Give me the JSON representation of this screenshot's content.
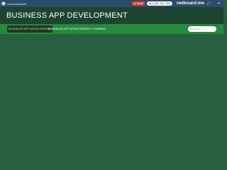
{
  "topbar": {
    "username": "coconutbeaver",
    "share_label": "Share",
    "share_icon": "share-icon",
    "stats": [
      {
        "icon": "eye-icon",
        "value": "2,145"
      },
      {
        "icon": "heart-icon",
        "value": "0"
      },
      {
        "icon": "comment-icon",
        "value": "0"
      }
    ],
    "brand": "netboard.me",
    "icons": [
      "expand-icon",
      "login-icon"
    ]
  },
  "header": {
    "title": "BUSINESS APP DEVELOPMENT"
  },
  "nav": {
    "items": [
      {
        "label": "BUSINESS APP DEVELOPMENT",
        "active": true
      },
      {
        "label": "BUSINESS APP DEVELOPMENT COMPANY",
        "active": false
      }
    ],
    "search_placeholder": "Search..."
  },
  "colors": {
    "topbar": "#2c4c6a",
    "header": "#1d4430",
    "nav": "#25893f",
    "active_tab_text": "#e7d84a",
    "content": "#27603f",
    "share_button": "#d9413d"
  }
}
